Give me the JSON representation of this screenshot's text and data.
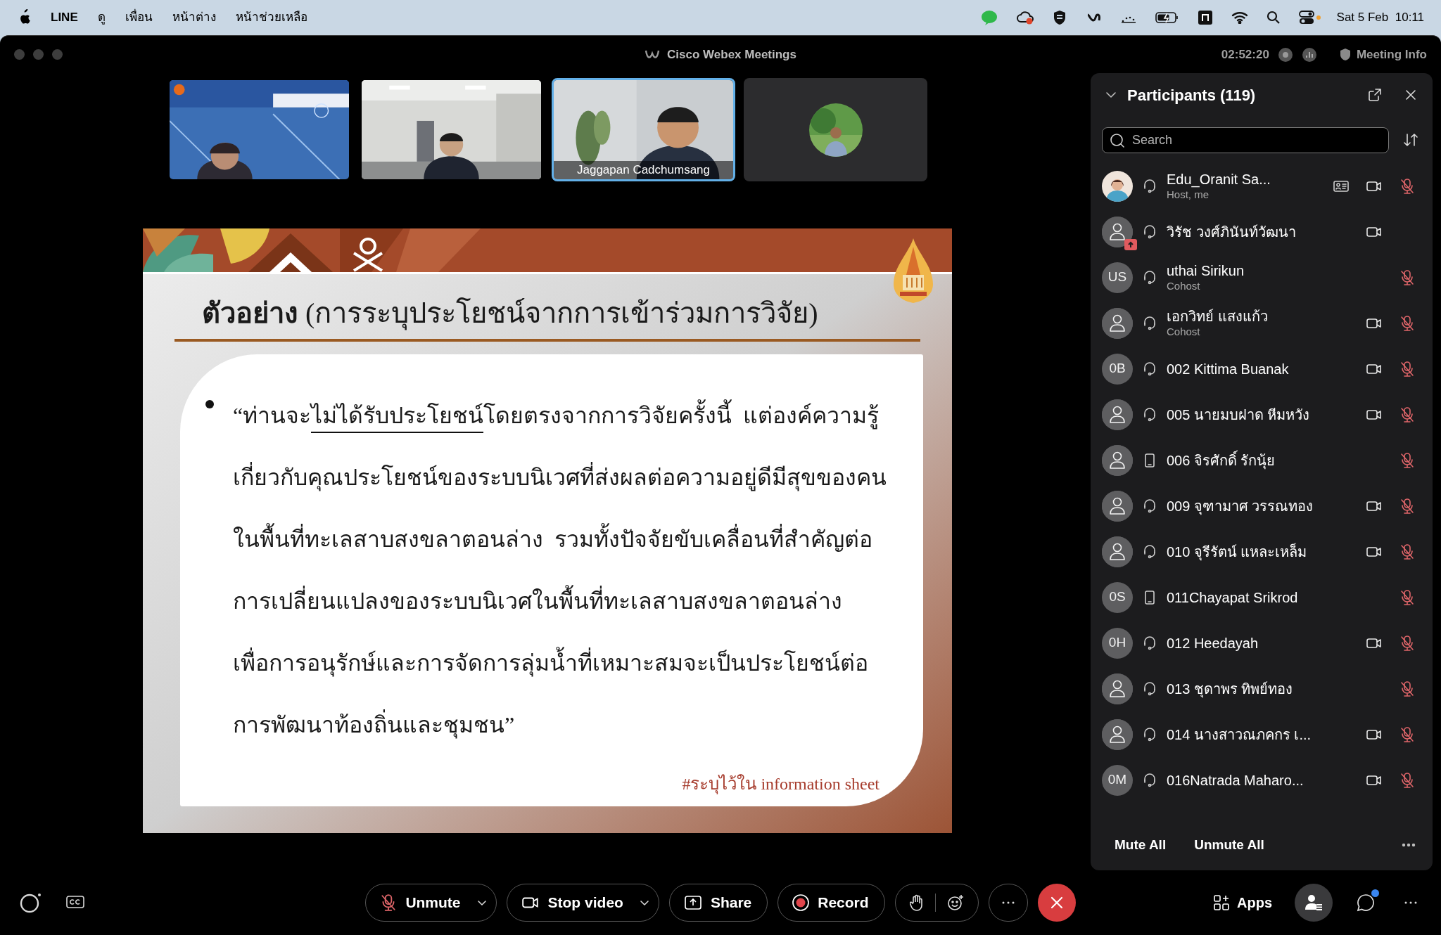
{
  "menu_bar": {
    "app": "LINE",
    "menus": [
      "ดู",
      "เพื่อน",
      "หน้าต่าง",
      "หน้าช่วยเหลือ"
    ],
    "clock": "Sat 5 Feb  10:11"
  },
  "window": {
    "title": "Cisco Webex Meetings",
    "elapsed": "02:52:20",
    "meeting_info": "Meeting Info"
  },
  "thumbnails": [
    {
      "video": true,
      "selected": false
    },
    {
      "video": true,
      "selected": false
    },
    {
      "video": true,
      "selected": true,
      "name": "Jaggapan Cadchumsang"
    },
    {
      "video": false,
      "selected": false
    }
  ],
  "slide": {
    "title": "**ตัวอย่าง** (การระบุประโยชน์จากการเข้าร่วมการวิจัย)",
    "lines": [
      [
        {
          "text": "“ท่านจะ",
          "underline": false
        },
        {
          "text": "ไม่ได้รับประโยชน์",
          "underline": true
        },
        {
          "text": "โดยตรงจากการวิจัยครั้งนี้  แต่องค์ความรู้",
          "underline": false
        }
      ],
      [
        {
          "text": "เกี่ยวกับคุณประโยชน์ของระบบนิเวศที่ส่งผลต่อความอยู่ดีมีสุขของคน",
          "underline": false
        }
      ],
      [
        {
          "text": "ในพื้นที่ทะเลสาบสงขลาตอนล่าง  รวมทั้งปัจจัยขับเคลื่อนที่สำคัญต่อ",
          "underline": false
        }
      ],
      [
        {
          "text": "การเปลี่ยนแปลงของระบบนิเวศในพื้นที่ทะเลสาบสงขลาตอนล่าง",
          "underline": false
        }
      ],
      [
        {
          "text": "เพื่อการอนุรักษ์และการจัดการลุ่มน้ำที่เหมาะสมจะเป็นประโยชน์ต่อ",
          "underline": false
        }
      ],
      [
        {
          "text": "การพัฒนาท้องถิ่นและชุมชน”",
          "underline": false
        }
      ]
    ],
    "note": "#ระบุไว้ใน information sheet"
  },
  "participants": {
    "title": "Participants (119)",
    "search": {
      "placeholder": "Search"
    },
    "rows": [
      {
        "name": "Edu_Oranit Sa...",
        "role": "Host, me",
        "sharing": false,
        "on_phone": false,
        "captions": true,
        "video": true,
        "muted": true
      },
      {
        "name": "วิรัช วงศ์ภินันท์วัฒนา",
        "kind": "person",
        "sharing": true,
        "on_phone": false,
        "captions": false,
        "video": true,
        "muted": false
      },
      {
        "name": "uthai Sirikun",
        "role": "Cohost",
        "kind": "initials",
        "initials": "US",
        "sharing": false,
        "on_phone": false,
        "captions": false,
        "video": false,
        "muted": true
      },
      {
        "name": "เอกวิทย์ แสงแก้ว",
        "role": "Cohost",
        "kind": "person",
        "sharing": false,
        "on_phone": false,
        "captions": false,
        "video": true,
        "muted": true
      },
      {
        "name": "002 Kittima Buanak",
        "kind": "initials",
        "initials": "0B",
        "sharing": false,
        "on_phone": false,
        "captions": false,
        "video": true,
        "muted": true
      },
      {
        "name": "005 นายมบฝาด หีมหวัง",
        "kind": "person",
        "sharing": false,
        "on_phone": false,
        "captions": false,
        "video": true,
        "muted": true
      },
      {
        "name": "006 จิรศักดิ์ รักนุ้ย",
        "kind": "person",
        "sharing": false,
        "on_phone": true,
        "captions": false,
        "video": false,
        "muted": true
      },
      {
        "name": "009 จุฑามาศ วรรณทอง",
        "kind": "person",
        "sharing": false,
        "on_phone": false,
        "captions": false,
        "video": true,
        "muted": true
      },
      {
        "name": "010 จุรีรัตน์ แหละเหล็ม",
        "kind": "person",
        "sharing": false,
        "on_phone": false,
        "captions": false,
        "video": true,
        "muted": true
      },
      {
        "name": "011Chayapat Srikrod",
        "kind": "initials",
        "initials": "0S",
        "sharing": false,
        "on_phone": true,
        "captions": false,
        "video": false,
        "muted": true
      },
      {
        "name": "012 Heedayah",
        "kind": "initials",
        "initials": "0H",
        "sharing": false,
        "on_phone": false,
        "captions": false,
        "video": true,
        "muted": true
      },
      {
        "name": "013 ชุดาพร ทิพย์ทอง",
        "kind": "person",
        "sharing": false,
        "on_phone": false,
        "captions": false,
        "video": false,
        "muted": true
      },
      {
        "name": "014 นางสาวณภคกร เ...",
        "kind": "person",
        "sharing": false,
        "on_phone": false,
        "captions": false,
        "video": true,
        "muted": true
      },
      {
        "name": "016Natrada Maharo...",
        "kind": "initials",
        "initials": "0M",
        "sharing": false,
        "on_phone": false,
        "captions": false,
        "video": true,
        "muted": true
      }
    ],
    "footer": [
      "Mute All",
      "Unmute All"
    ]
  },
  "toolbar": {
    "buttons": [
      {
        "kind": "unmute",
        "label": "Unmute",
        "menu": true
      },
      {
        "kind": "video",
        "label": "Stop video",
        "menu": true
      },
      {
        "kind": "share",
        "label": "Share",
        "menu": false
      },
      {
        "kind": "record",
        "label": "Record",
        "menu": false
      }
    ],
    "apps": "Apps",
    "participants_selected": true,
    "chat_unread": true
  }
}
